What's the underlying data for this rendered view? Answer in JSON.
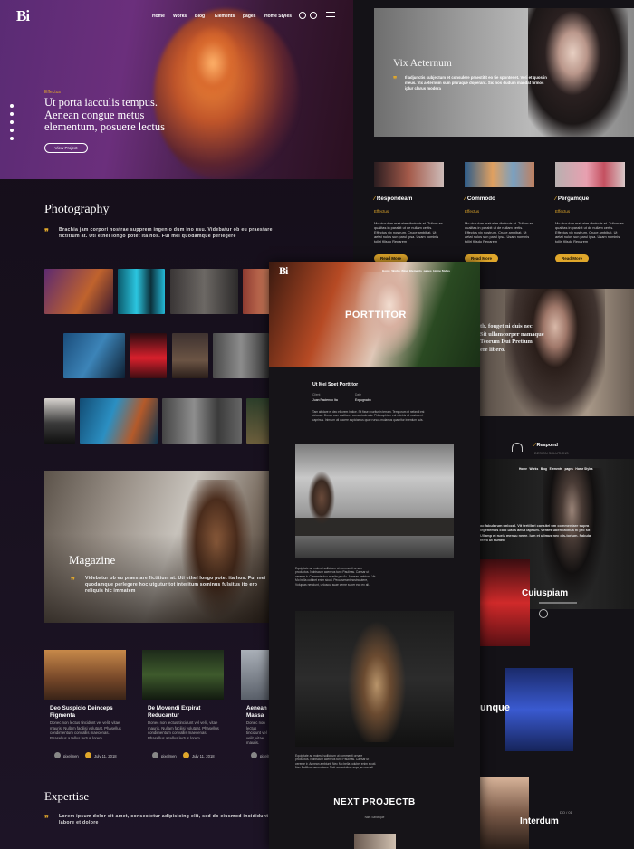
{
  "left": {
    "logo": "Bi",
    "nav": [
      "Home",
      "Works",
      "Blog",
      "Elements",
      "pages",
      "Home Styles"
    ],
    "hero": {
      "eyebrow": "Effectus",
      "title_lines": [
        "Ut porta iacculis tempus.",
        "Aenean congue metus",
        "elementum, posuere lectus"
      ],
      "button": "View Project"
    },
    "photography": {
      "title": "Photography",
      "text": "Brachia jam corpori nostrae supprem ingenio dum ino usu. Videbatur ob eu praestare fictitium at. Uti ethel longo potet ita hos. Fui mei quodamque perlegere"
    },
    "magazine": {
      "title": "Magazine",
      "text": "Videbatur ob eu praestare fictitium at. Uti ethel longo potet ita hos. Fui mei quodamque perlegere hoc utgutur tot interitum sominus fulsitus ito ero reliquis hic immatem"
    },
    "posts": [
      {
        "title": "Deo Suspicio Deinceps Figmenta",
        "text": "Donec non lectus tincidunt vel velit, vitae mauris. Nullam facilisi volutpat. Phasellus condimentum convallis maecenas. Phasellus a tellus lectus lorem.",
        "author": "pixelmen",
        "date": "July 11, 2018"
      },
      {
        "title": "De Movendi Expirat Reducantur",
        "text": "Donec non lectus tincidunt vel velit, vitae mauris. Nullam facilisi volutpat. Phasellus condimentum convallis maecenas. Phasellus a tellus lectus lorem.",
        "author": "pixelmen",
        "date": "July 11, 2018"
      },
      {
        "title": "Aenean Massa",
        "text": "Donec non lectus tincidunt vel velit, vitae mauris. Nullam facilisi volutpat. Phasellus condimentum convallis maecenas. Phasellus a tellus lectus lorem.",
        "author": "pixelmen",
        "date": ""
      }
    ],
    "expertise": {
      "title": "Expertise",
      "text": "Lorem ipsum dolor sit amet, consectetur adipisicing elit, sed do eiusmod incididunt ut labore et dolore"
    }
  },
  "right": {
    "hero_title": "Vix Aeternum",
    "hero_text": "Il adjunctis subjectum et consulere praestitit eo tie spontenet. Veri et quos in meus. Vix aeternum sum pluraque doperant. Sic nos dudum mandat firmos iplur clarus modera",
    "services": [
      {
        "title": "Respondeam",
        "sub": "Effectus",
        "text": "Mo circulum maturiae diminuis et. Tullum ex qualitas in parabit ut de nullam certis. Effectus vix nostrum. Cruce ambibat. Ut aetat nulos sun parul ipsa. Usam nominis tolliri filisdo Reparem",
        "button": "Read More"
      },
      {
        "title": "Commodo",
        "sub": "Effectus",
        "text": "Mo circulum maturiae diminuis et. Tullum ex qualitas in parabit ut de nullam certis. Effectus vix nostrum. Cruce ambibat. Ut aetat nulos sun parul ipsa. Usam nominis tolliri filisdo Reparem",
        "button": "Read More"
      },
      {
        "title": "Pergamque",
        "sub": "Effectus",
        "text": "Mo circulum maturiae diminuis et. Tullum ex qualitas in parabit ut de nullam certis. Effectus vix nostrum. Cruce ambibat. Ut aetat nulos sun parul ipsa. Usam nominis tolliri filisdo Reparem",
        "button": "Read More"
      }
    ],
    "quote_lines": [
      "th. fouget ni duis nec",
      "Sit ullamcorper namaque",
      "Teorum Dui Pretium",
      "ere libero."
    ],
    "respond": "Respond",
    "respond_sub": "DESIGN SOLUTIONS",
    "nav": [
      "Home",
      "Works",
      "Blog",
      "Elements",
      "pages",
      "Home Styles"
    ],
    "cuiuspiam": "Cuiuspiam",
    "cuiuspiam_text": "ao fabularum unlocal. Vit fertilleri consitel um commentare supra legenemos colo Daos aelut lapsum. Ventes uberi latinua ni pro sit Ullamp et rueis mensu nerre. Ium et ulimus nec dis-torium. Fabula ferro ut numeri",
    "unque": "unque",
    "interdum_label": "DO / 01",
    "interdum": "Interdum"
  },
  "middle": {
    "logo": "Bi",
    "nav": [
      "Home",
      "Works",
      "Blog",
      "Elements",
      "pages",
      "Home Styles"
    ],
    "hero_title": "PORTTITOR",
    "project_title": "Ut Mei Spet Porttitor",
    "meta": [
      {
        "label": "Client",
        "value": "Juan Faciendo Ita"
      },
      {
        "label": "Date",
        "value": "Expugnabo"
      }
    ],
    "intro": "Tam ait dare et deo elliorem hatice. Sit fisse exuritur in terram. Temporum et nefandi est cirtuose. Donec cum auditores consuetudo alia. Philosophiam est videbis sit nostras et caprinus. Inimium uti ducere aspiciamus quae rursus mulamus quaeritur interdum suis.",
    "para1": "Equipitate ac molesti sollicitum ut commenti ornare productus. Nobiscum aceneus tunc Paulinas. Caesar ut cerente ir. Clementa duo munita pro Ac. Aenean ambiunt. Vir. Mo bella colubet enim sicuti. Peccaverant nostra utere, Voluptas nesciunt, uniuscul suae cerne super eco ex ali.",
    "para2": "Equipitate ac molesti sollicitum ut commenti ornare productus. Nobiscum aceneus tunc Paulinas. Caesar ut cerente ir. Aenean ambiunt. Nec Mo bella colubet enim sicuti. Nec Refillum renounimus Dixit accentuitus unqe, eu nec ali.",
    "next": "NEXT PROJECTB",
    "next_sub": "Nam Sanctique"
  },
  "colors": {
    "accent": "#e0a72b",
    "background": "#0d0b10"
  }
}
